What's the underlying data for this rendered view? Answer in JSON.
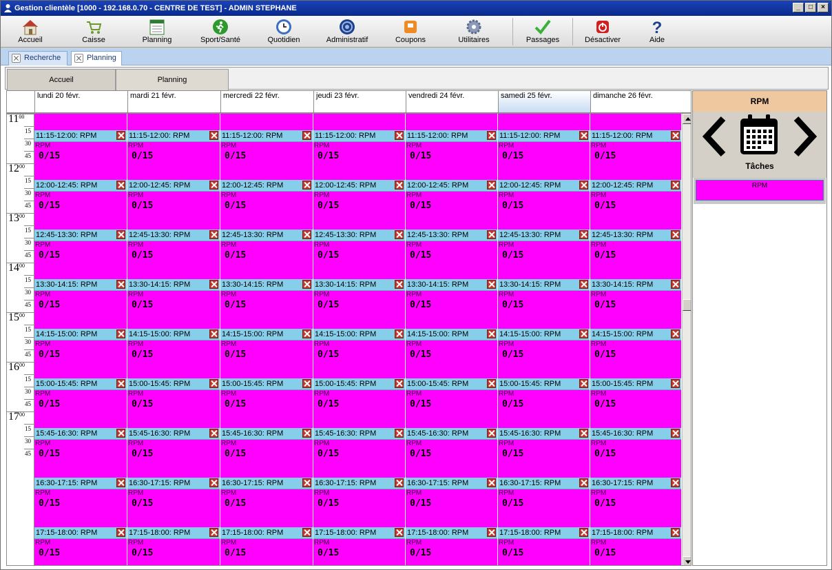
{
  "window": {
    "title": "Gestion clientèle [1000 - 192.168.0.70 - CENTRE DE TEST] - ADMIN STEPHANE"
  },
  "toolbar": {
    "items": [
      {
        "label": "Accueil",
        "icon": "home-icon"
      },
      {
        "label": "Caisse",
        "icon": "cart-icon"
      },
      {
        "label": "Planning",
        "icon": "planning-icon"
      },
      {
        "label": "Sport/Santé",
        "icon": "runner-icon"
      },
      {
        "label": "Quotidien",
        "icon": "clock-icon"
      },
      {
        "label": "Administratif",
        "icon": "admin-icon"
      },
      {
        "label": "Coupons",
        "icon": "coupon-icon"
      },
      {
        "label": "Utilitaires",
        "icon": "gear-icon"
      },
      {
        "label": "Passages",
        "icon": "checkmark-icon"
      },
      {
        "label": "Désactiver",
        "icon": "power-icon"
      },
      {
        "label": "Aide",
        "icon": "help-icon"
      }
    ]
  },
  "doc_tabs": [
    {
      "label": "Recherche"
    },
    {
      "label": "Planning"
    }
  ],
  "inner_tabs": [
    {
      "label": "Accueil"
    },
    {
      "label": "Planning"
    }
  ],
  "days": [
    "lundi 20 févr.",
    "mardi 21 févr.",
    "mercredi 22 févr.",
    "jeudi 23 févr.",
    "vendredi 24 févr.",
    "samedi 25 févr.",
    "dimanche 26 févr."
  ],
  "selected_day": 5,
  "hours": [
    "11",
    "12",
    "13",
    "14",
    "15",
    "16",
    "17"
  ],
  "hour_sup": "00",
  "quarters": [
    "15",
    "30",
    "45"
  ],
  "events": [
    {
      "time": "11:15-12:00: RPM",
      "name": "RPM",
      "count": "0/15"
    },
    {
      "time": "12:00-12:45: RPM",
      "name": "RPM",
      "count": "0/15"
    },
    {
      "time": "12:45-13:30: RPM",
      "name": "RPM",
      "count": "0/15"
    },
    {
      "time": "13:30-14:15: RPM",
      "name": "RPM",
      "count": "0/15"
    },
    {
      "time": "14:15-15:00: RPM",
      "name": "RPM",
      "count": "0/15"
    },
    {
      "time": "15:00-15:45: RPM",
      "name": "RPM",
      "count": "0/15"
    },
    {
      "time": "15:45-16:30: RPM",
      "name": "RPM",
      "count": "0/15"
    },
    {
      "time": "16:30-17:15: RPM",
      "name": "RPM",
      "count": "0/15"
    },
    {
      "time": "17:15-18:00: RPM",
      "name": "RPM",
      "count": "0/15"
    }
  ],
  "right_panel": {
    "header": "RPM",
    "tasks_label": "Tâches",
    "task_items": [
      "RPM"
    ],
    "event_color": "#ff00ff",
    "header_color": "#87ceeb"
  }
}
